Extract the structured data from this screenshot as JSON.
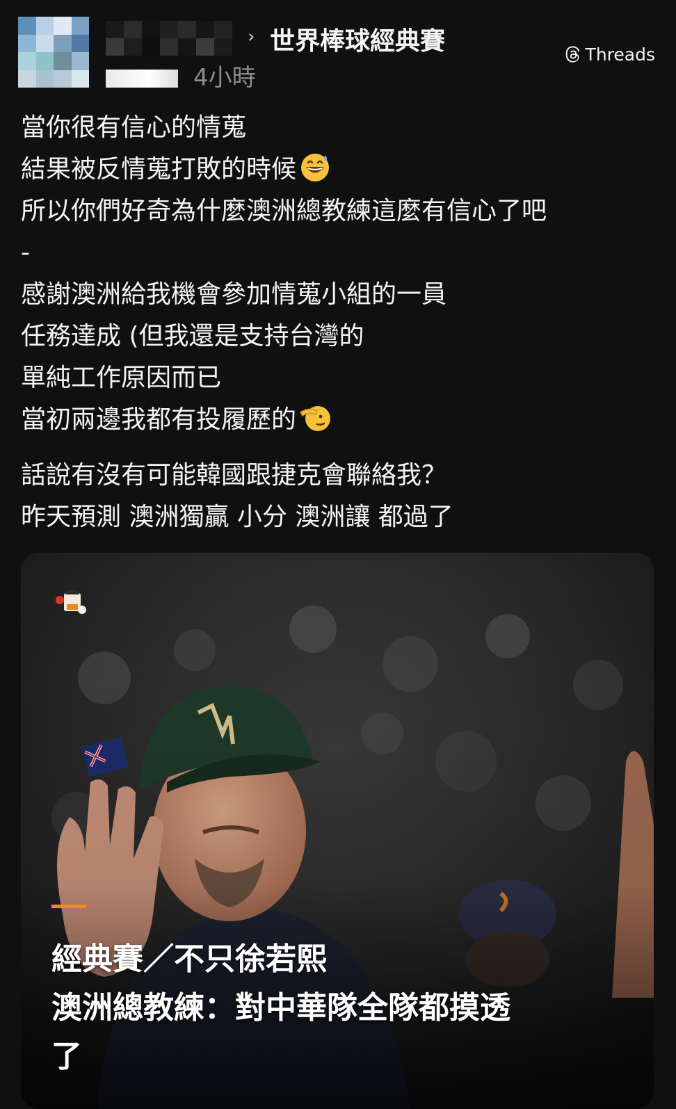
{
  "header": {
    "community": "世界棒球經典賽",
    "timestamp": "4小時",
    "brand": "Threads"
  },
  "post": {
    "lines_block1": [
      "當你很有信心的情蒐",
      "結果被反情蒐打敗的時候",
      "所以你們好奇為什麼澳洲總教練這麼有信心了吧",
      "-",
      "感謝澳洲給我機會參加情蒐小組的一員",
      "任務達成 (但我還是支持台灣的",
      "單純工作原因而已",
      "當初兩邊我都有投履歷的"
    ],
    "lines_block2": [
      "話說有沒有可能韓國跟捷克會聯絡我？",
      "昨天預測  澳洲獨贏 小分 澳洲讓 都過了"
    ],
    "emojis": [
      "grinning-sweat-emoji",
      "saluting-face-emoji"
    ]
  },
  "card": {
    "headline_lines": [
      "經典賽／不只徐若熙",
      "澳洲總教練：對中華隊全隊都摸透",
      "了"
    ],
    "accent_color": "#f08a1c"
  },
  "colors": {
    "background": "#101010",
    "text": "#f4f4f4",
    "muted": "#8c8c8c"
  }
}
